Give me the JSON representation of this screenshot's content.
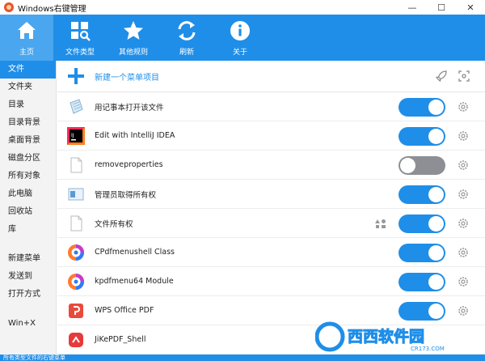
{
  "window": {
    "title": "Windows右键管理",
    "minimize": "—",
    "maximize": "☐",
    "close": "✕"
  },
  "toolbar": [
    {
      "label": "主页",
      "icon": "home-icon",
      "active": true
    },
    {
      "label": "文件类型",
      "icon": "file-type-search-icon",
      "active": false
    },
    {
      "label": "其他规则",
      "icon": "star-icon",
      "active": false
    },
    {
      "label": "刷新",
      "icon": "refresh-icon",
      "active": false
    },
    {
      "label": "关于",
      "icon": "info-icon",
      "active": false
    }
  ],
  "sidebar": {
    "items": [
      "文件",
      "文件夹",
      "目录",
      "目录背景",
      "桌面背景",
      "磁盘分区",
      "所有对象",
      "此电脑",
      "回收站",
      "库"
    ],
    "items2": [
      "新建菜单",
      "发送到",
      "打开方式"
    ],
    "items3": [
      "Win+X"
    ],
    "active": "文件"
  },
  "main": {
    "new_item_label": "新建一个菜单项目",
    "rows": [
      {
        "label": "用记事本打开该文件",
        "icon": "notepad-icon",
        "on": true,
        "extra": false
      },
      {
        "label": "Edit with IntelliJ IDEA",
        "icon": "intellij-icon",
        "on": true,
        "extra": false
      },
      {
        "label": "removeproperties",
        "icon": "blank-file-icon",
        "on": false,
        "extra": false
      },
      {
        "label": "管理员取得所有权",
        "icon": "admin-window-icon",
        "on": true,
        "extra": false
      },
      {
        "label": "文件所有权",
        "icon": "blank-file-icon",
        "on": true,
        "extra": true
      },
      {
        "label": "CPdfmenushell Class",
        "icon": "kpdf-icon",
        "on": true,
        "extra": false
      },
      {
        "label": "kpdfmenu64 Module",
        "icon": "kpdf-icon",
        "on": true,
        "extra": false
      },
      {
        "label": "WPS Office PDF",
        "icon": "wps-pdf-icon",
        "on": true,
        "extra": false
      },
      {
        "label": "JiKePDF_Shell",
        "icon": "jikepdf-icon",
        "on": true,
        "extra": false
      }
    ]
  },
  "statusbar": {
    "text": "所有类型文件的右键菜单"
  },
  "watermark": {
    "text": "西西软件园",
    "sub": "CR173.COM"
  },
  "colors": {
    "accent": "#1f8ee8",
    "toggle_off": "#8d8f94"
  }
}
